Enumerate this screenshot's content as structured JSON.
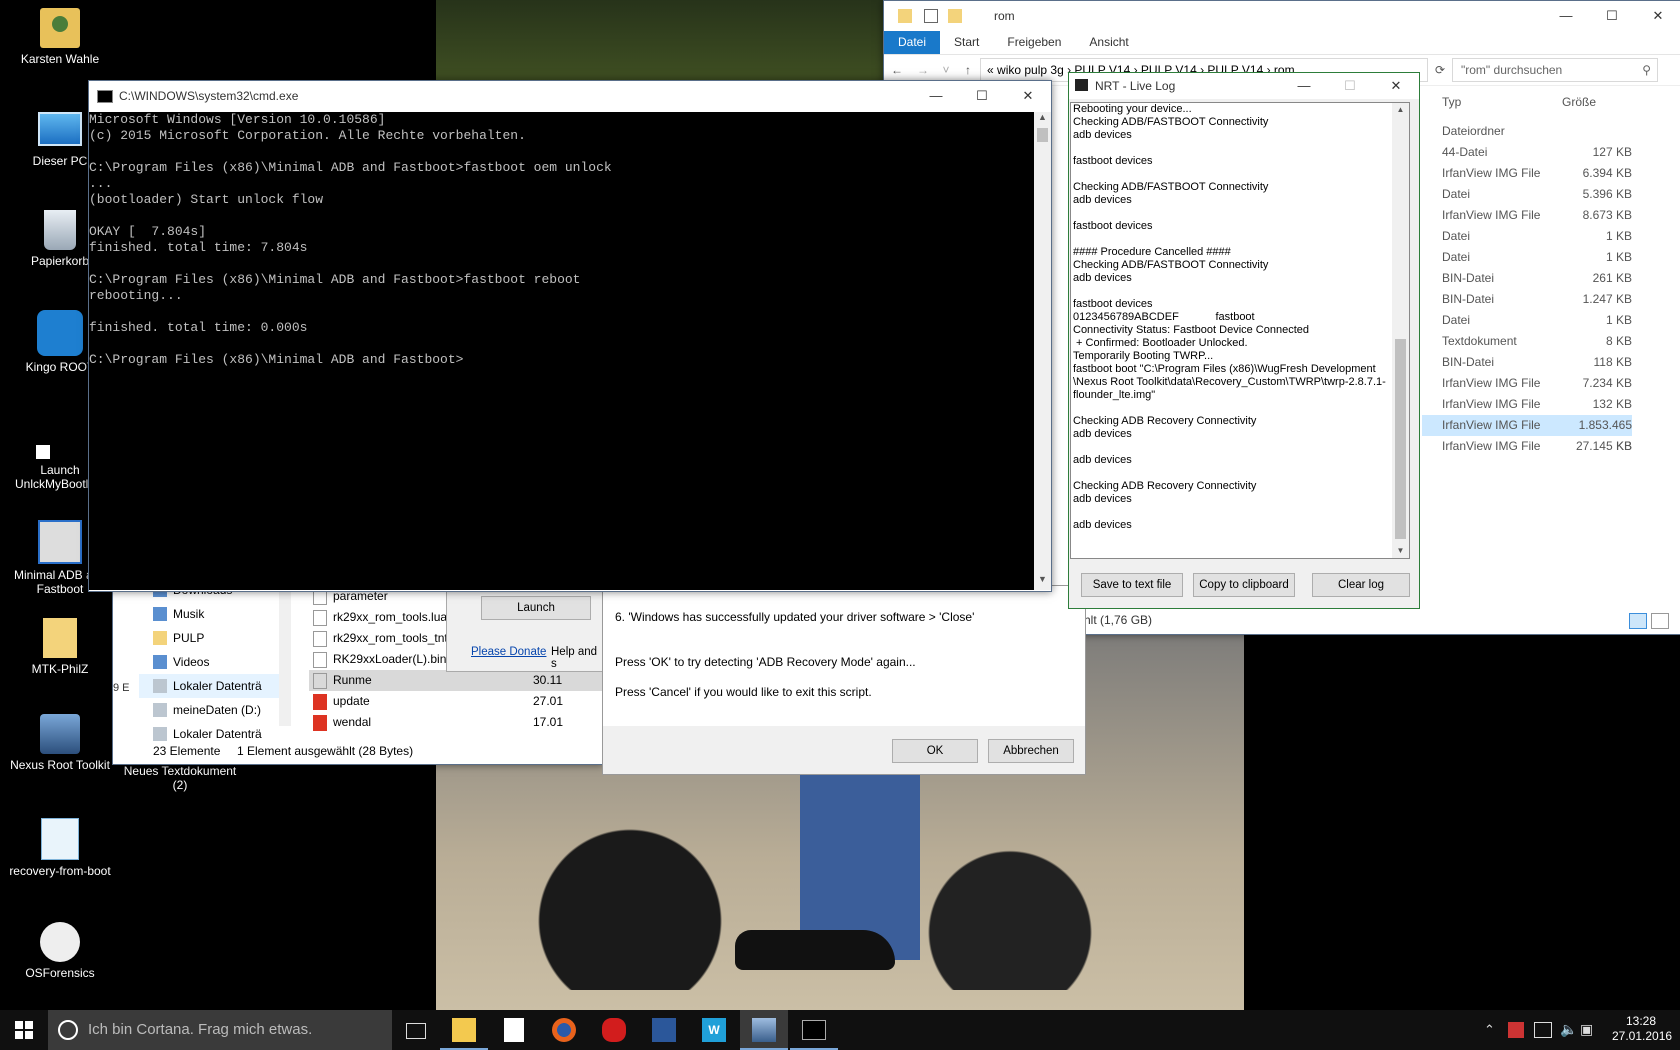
{
  "desktop": {
    "icons": [
      {
        "label": "Karsten Wahle",
        "icon": "user-folder-icon"
      },
      {
        "label": "Dieser PC",
        "icon": "computer-icon"
      },
      {
        "label": "Papierkorb",
        "icon": "recycle-bin-icon"
      },
      {
        "label": "Kingo ROOT",
        "icon": "kingo-root-icon"
      },
      {
        "label": "Launch UnlckMyBootlo...",
        "icon": "shortcut-icon"
      },
      {
        "label": "Minimal ADB and Fastboot",
        "icon": "cmd-shortcut-icon"
      },
      {
        "label": "MTK-PhilZ",
        "icon": "folder-icon"
      },
      {
        "label": "Nexus Root Toolkit",
        "icon": "nexus-root-toolkit-icon"
      },
      {
        "label": "recovery-from-boot",
        "icon": "notepad-icon"
      },
      {
        "label": "OSForensics",
        "icon": "osforensics-icon"
      }
    ],
    "extra_icon": {
      "label": "Neues Textdokument (2)",
      "icon": "text-document-icon"
    }
  },
  "cmd": {
    "title": "C:\\WINDOWS\\system32\\cmd.exe",
    "lines": [
      "Microsoft Windows [Version 10.0.10586]",
      "(c) 2015 Microsoft Corporation. Alle Rechte vorbehalten.",
      "",
      "C:\\Program Files (x86)\\Minimal ADB and Fastboot>fastboot oem unlock",
      "...",
      "(bootloader) Start unlock flow",
      "",
      "OKAY [  7.804s]",
      "finished. total time: 7.804s",
      "",
      "C:\\Program Files (x86)\\Minimal ADB and Fastboot>fastboot reboot",
      "rebooting...",
      "",
      "finished. total time: 0.000s",
      "",
      "C:\\Program Files (x86)\\Minimal ADB and Fastboot>"
    ]
  },
  "explorer": {
    "title": "rom",
    "tabs": [
      "Datei",
      "Start",
      "Freigeben",
      "Ansicht"
    ],
    "breadcrumb": [
      "«",
      "wiko pulp 3g",
      "PULP V14",
      "PULP V14",
      "PULP V14",
      "rom"
    ],
    "search_placeholder": "\"rom\" durchsuchen",
    "columns": {
      "type": "Typ",
      "size": "Größe"
    },
    "rows": [
      {
        "type": "Dateiordner",
        "size": ""
      },
      {
        "type": "44-Datei",
        "size": "127 KB"
      },
      {
        "type": "IrfanView IMG File",
        "size": "6.394 KB"
      },
      {
        "type": "Datei",
        "size": "5.396 KB"
      },
      {
        "type": "IrfanView IMG File",
        "size": "8.673 KB"
      },
      {
        "type": "Datei",
        "size": "1 KB"
      },
      {
        "type": "Datei",
        "size": "1 KB"
      },
      {
        "type": "BIN-Datei",
        "size": "261 KB"
      },
      {
        "type": "BIN-Datei",
        "size": "1.247 KB"
      },
      {
        "type": "Datei",
        "size": "1 KB"
      },
      {
        "type": "Textdokument",
        "size": "8 KB"
      },
      {
        "type": "BIN-Datei",
        "size": "118 KB"
      },
      {
        "type": "IrfanView IMG File",
        "size": "7.234 KB"
      },
      {
        "type": "IrfanView IMG File",
        "size": "132 KB"
      },
      {
        "type": "IrfanView IMG File",
        "size": "1.853.465 KB"
      },
      {
        "type": "IrfanView IMG File",
        "size": "27.145 KB"
      }
    ],
    "selected_row": 14,
    "status_fragment": "hlt (1,76 GB)"
  },
  "nrt_log": {
    "title": "NRT - Live Log",
    "lines": [
      "Rebooting your device...",
      "Checking ADB/FASTBOOT Connectivity",
      "adb devices",
      "",
      "fastboot devices",
      "",
      "Checking ADB/FASTBOOT Connectivity",
      "adb devices",
      "",
      "fastboot devices",
      "",
      "#### Procedure Cancelled ####",
      "Checking ADB/FASTBOOT Connectivity",
      "adb devices",
      "",
      "fastboot devices",
      "0123456789ABCDEF            fastboot",
      "Connectivity Status: Fastboot Device Connected",
      " + Confirmed: Bootloader Unlocked.",
      "Temporarily Booting TWRP...",
      "fastboot boot \"C:\\Program Files (x86)\\WugFresh Development",
      "\\Nexus Root Toolkit\\data\\Recovery_Custom\\TWRP\\twrp-2.8.7.1-",
      "flounder_lte.img\"",
      "",
      "Checking ADB Recovery Connectivity",
      "adb devices",
      "",
      "adb devices",
      "",
      "Checking ADB Recovery Connectivity",
      "adb devices",
      "",
      "adb devices"
    ],
    "buttons": {
      "save": "Save to text file",
      "copy": "Copy to clipboard",
      "clear": "Clear log"
    }
  },
  "explorer2": {
    "nav": [
      {
        "label": "Downloads",
        "icon": "download-icon"
      },
      {
        "label": "Musik",
        "icon": "music-icon"
      },
      {
        "label": "PULP",
        "icon": "folder-icon"
      },
      {
        "label": "Videos",
        "icon": "video-icon"
      },
      {
        "label": "Lokaler Datenträ",
        "icon": "drive-icon"
      },
      {
        "label": "meineDaten (D:)",
        "icon": "drive-icon"
      },
      {
        "label": "Lokaler Datenträ",
        "icon": "drive-icon"
      }
    ],
    "files": [
      {
        "name": "parameter",
        "date": ""
      },
      {
        "name": "rk29xx_rom_tools.lua",
        "date": ""
      },
      {
        "name": "rk29xx_rom_tools_tnt...",
        "date": ""
      },
      {
        "name": "RK29xxLoader(L).bin",
        "date": ""
      },
      {
        "name": "Runme",
        "date": "30.11"
      },
      {
        "name": "update",
        "date": "27.01"
      },
      {
        "name": "wendal",
        "date": "17.01"
      }
    ],
    "status_count": "23 Elemente",
    "status_selected": "1 Element ausgewählt (28 Bytes)",
    "side_count": "9 E"
  },
  "nrt_main": {
    "launch": "Launch",
    "donate": "Please Donate",
    "help": "Help and s"
  },
  "dialog": {
    "line1": "6. 'Windows has successfully updated your driver software > 'Close'",
    "line2": "Press 'OK' to try detecting 'ADB Recovery Mode' again...",
    "line3": "Press 'Cancel' if you would like to exit this script.",
    "ok": "OK",
    "cancel": "Abbrechen"
  },
  "taskbar": {
    "cortana_placeholder": "Ich bin Cortana. Frag mich etwas.",
    "time": "13:28",
    "date": "27.01.2016",
    "apps": [
      "file-explorer-icon",
      "store-icon",
      "firefox-icon",
      "app-red-icon",
      "word-icon",
      "writer-icon",
      "nexus-root-toolkit-icon",
      "cmd-icon"
    ]
  }
}
